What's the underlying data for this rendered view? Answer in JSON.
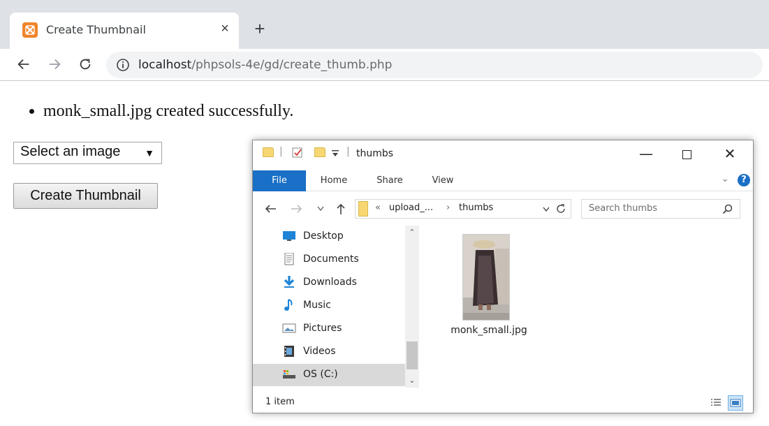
{
  "browser": {
    "tab_title": "Create Thumbnail",
    "tab_close": "×",
    "new_tab": "+",
    "url_host": "localhost",
    "url_path": "/phpsols-4e/gd/create_thumb.php"
  },
  "page": {
    "message": "monk_small.jpg created successfully.",
    "select_value": "Select an image",
    "select_arrow": "▼",
    "create_button": "Create Thumbnail"
  },
  "explorer": {
    "title": "thumbs",
    "ribbon_tabs": [
      "File",
      "Home",
      "Share",
      "View"
    ],
    "help": "?",
    "address": {
      "prefix": "«",
      "parent": "upload_...",
      "separator": "›",
      "current": "thumbs"
    },
    "search_placeholder": "Search thumbs",
    "nav_items": [
      {
        "label": "Desktop",
        "icon": "desktop-icon"
      },
      {
        "label": "Documents",
        "icon": "documents-icon"
      },
      {
        "label": "Downloads",
        "icon": "downloads-icon"
      },
      {
        "label": "Music",
        "icon": "music-icon"
      },
      {
        "label": "Pictures",
        "icon": "pictures-icon"
      },
      {
        "label": "Videos",
        "icon": "videos-icon"
      },
      {
        "label": "OS (C:)",
        "icon": "drive-icon"
      }
    ],
    "file_name": "monk_small.jpg",
    "status": "1 item"
  },
  "colors": {
    "accent_blue": "#1a6fc6",
    "tab_strip": "#dee1e6",
    "favicon_orange": "#f0852a",
    "folder_yellow": "#f7d774"
  }
}
